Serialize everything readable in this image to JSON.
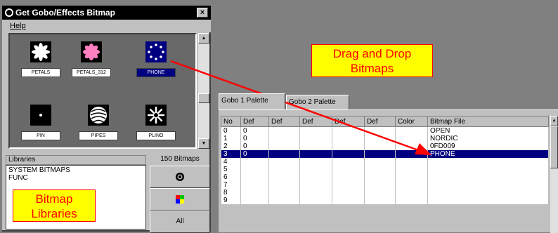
{
  "window": {
    "title": "Get Gobo/Effects Bitmap",
    "close_glyph": "×"
  },
  "menu": {
    "help": "Help"
  },
  "gobos": [
    {
      "label": "PETALS",
      "icon": "petals-icon",
      "selected": false
    },
    {
      "label": "PETALS_312",
      "icon": "petals-pink-icon",
      "selected": false
    },
    {
      "label": "PHONE",
      "icon": "phone-dots-icon",
      "selected": true
    },
    {
      "label": "PIN",
      "icon": "pin-icon",
      "selected": false
    },
    {
      "label": "PIPES",
      "icon": "pipes-icon",
      "selected": false
    },
    {
      "label": "PLINO",
      "icon": "plino-icon",
      "selected": false
    }
  ],
  "libraries": {
    "header": "Libraries",
    "count": "150 Bitmaps",
    "items": [
      "SYSTEM BITMAPS",
      "FUNC"
    ],
    "all_label": "All"
  },
  "callouts": {
    "drag_drop": "Drag and Drop Bitmaps",
    "libraries": "Bitmap Libraries"
  },
  "tabs": [
    "Gobo 1 Palette",
    "Gobo 2 Palette"
  ],
  "table": {
    "columns": [
      "No",
      "Def",
      "Def",
      "Def",
      "Def",
      "Def",
      "Color",
      "Bitmap File"
    ],
    "rows": [
      {
        "no": "0",
        "def": "0",
        "file": "OPEN"
      },
      {
        "no": "1",
        "def": "0",
        "file": "NORDIC"
      },
      {
        "no": "2",
        "def": "0",
        "file": "0FD009"
      },
      {
        "no": "3",
        "def": "0",
        "file": "PHONE"
      },
      {
        "no": "4",
        "def": "",
        "file": ""
      },
      {
        "no": "5",
        "def": "",
        "file": ""
      },
      {
        "no": "6",
        "def": "",
        "file": ""
      },
      {
        "no": "7",
        "def": "",
        "file": ""
      },
      {
        "no": "8",
        "def": "",
        "file": ""
      },
      {
        "no": "9",
        "def": "",
        "file": ""
      }
    ],
    "selected_row": 3
  },
  "colors": {
    "accent": "#000080",
    "callout_bg": "#ffff00",
    "callout_fg": "#ff0000",
    "arrow": "#ff0000"
  }
}
